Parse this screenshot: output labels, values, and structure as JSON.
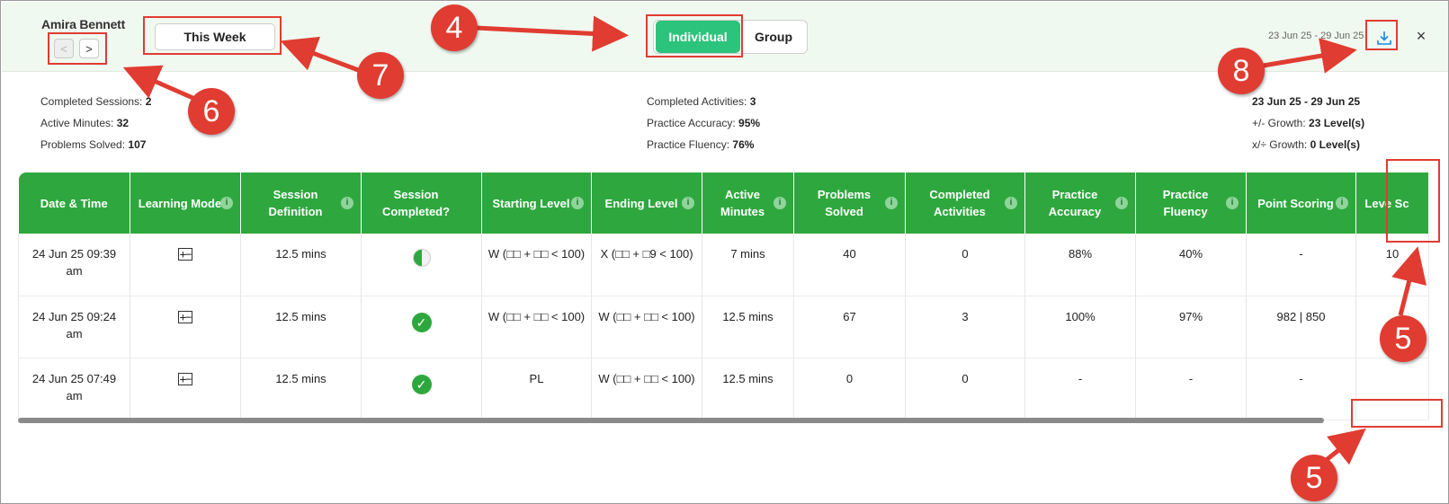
{
  "header": {
    "student_name": "Amira Bennett",
    "prev_label": "<",
    "next_label": ">",
    "week_button": "This Week",
    "view_toggle": {
      "individual": "Individual",
      "group": "Group"
    },
    "date_range": "23 Jun 25 - 29 Jun 25",
    "download_icon": "download-icon",
    "close_label": "×"
  },
  "stats": {
    "left": [
      {
        "label": "Completed Sessions:",
        "value": "2"
      },
      {
        "label": "Active Minutes:",
        "value": "32"
      },
      {
        "label": "Problems Solved:",
        "value": "107"
      }
    ],
    "middle": [
      {
        "label": "Completed Activities:",
        "value": "3"
      },
      {
        "label": "Practice Accuracy:",
        "value": "95%"
      },
      {
        "label": "Practice Fluency:",
        "value": "76%"
      }
    ],
    "right": {
      "range": "23 Jun 25 - 29 Jun 25",
      "rows": [
        {
          "label": "+/- Growth:",
          "value": "23 Level(s)"
        },
        {
          "label": "x/÷ Growth:",
          "value": "0 Level(s)"
        }
      ]
    }
  },
  "table": {
    "headers": [
      "Date & Time",
      "Learning Mode",
      "Session Definition",
      "Session Completed?",
      "Starting Level",
      "Ending Level",
      "Active Minutes",
      "Problems Solved",
      "Completed Activities",
      "Practice Accuracy",
      "Practice Fluency",
      "Point Scoring",
      "Leve Sc"
    ],
    "rows": [
      [
        "24 Jun 25 09:39 am",
        "+−",
        "12.5 mins",
        "half",
        "W (□□ + □□ < 100)",
        "X (□□ + □9 < 100)",
        "7 mins",
        "40",
        "0",
        "88%",
        "40%",
        "-",
        "10"
      ],
      [
        "24 Jun 25 09:24 am",
        "+−",
        "12.5 mins",
        "check",
        "W (□□ + □□ < 100)",
        "W (□□ + □□ < 100)",
        "12.5 mins",
        "67",
        "3",
        "100%",
        "97%",
        "982 | 850",
        ""
      ],
      [
        "24 Jun 25 07:49 am",
        "+−",
        "12.5 mins",
        "check",
        "PL",
        "W (□□ + □□ < 100)",
        "12.5 mins",
        "0",
        "0",
        "-",
        "-",
        "-",
        ""
      ]
    ]
  },
  "annotations": {
    "badge_4": "4",
    "badge_5a": "5",
    "badge_5b": "5",
    "badge_6": "6",
    "badge_7": "7",
    "badge_8": "8",
    "accent": "#e03c31"
  }
}
